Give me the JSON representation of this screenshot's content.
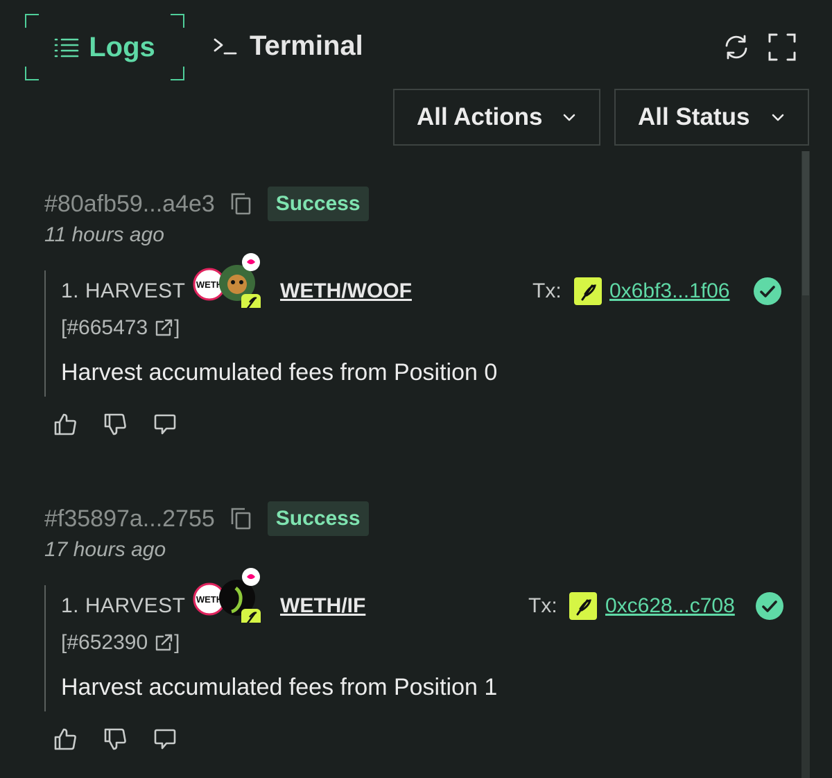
{
  "tabs": {
    "logs": "Logs",
    "terminal": "Terminal"
  },
  "icons": {
    "refresh": "refresh-icon",
    "fullscreen": "fullscreen-icon"
  },
  "filters": {
    "actions": "All Actions",
    "status": "All Status"
  },
  "colors": {
    "accent": "#5fd9a6",
    "lime": "#d6f545",
    "background": "#1b201f"
  },
  "entries": [
    {
      "hash": "#80afb59...a4e3",
      "status": "Success",
      "time": "11 hours ago",
      "action": "1. HARVEST",
      "pair": "WETH/WOOF",
      "tx_label": "Tx:",
      "tx": "0x6bf3...1f06",
      "position_id": "[#665473",
      "position_close": "]",
      "token_a": "WETH",
      "description": "Harvest accumulated fees from Position 0"
    },
    {
      "hash": "#f35897a...2755",
      "status": "Success",
      "time": "17 hours ago",
      "action": "1. HARVEST",
      "pair": "WETH/IF",
      "tx_label": "Tx:",
      "tx": "0xc628...c708",
      "position_id": "[#652390",
      "position_close": "]",
      "token_a": "WETH",
      "description": "Harvest accumulated fees from Position 1"
    }
  ]
}
